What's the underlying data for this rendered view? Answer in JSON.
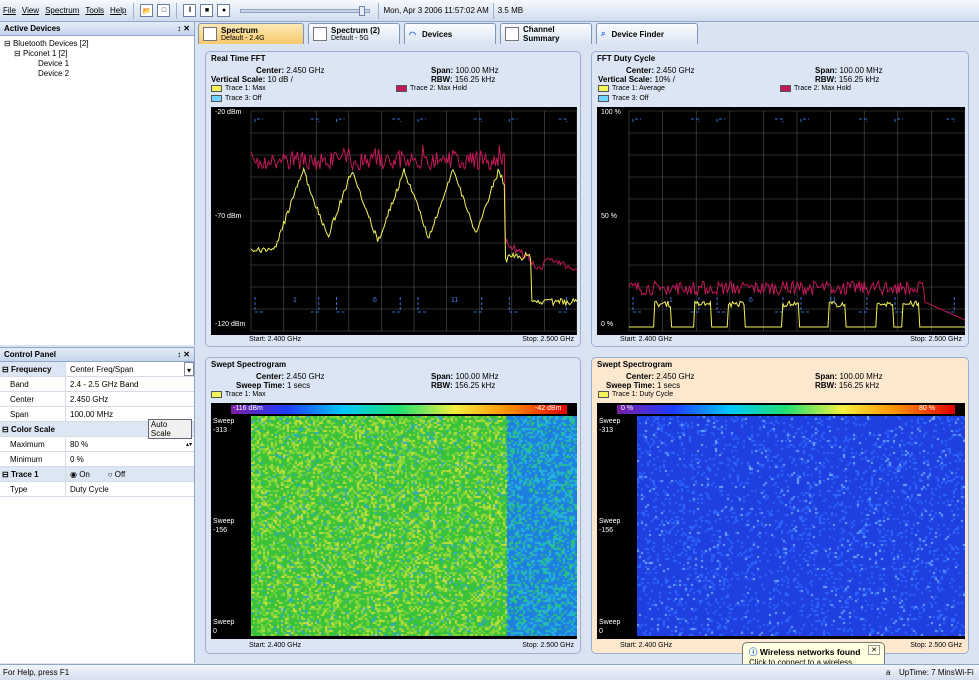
{
  "menu": {
    "file": "File",
    "view": "View",
    "spectrum": "Spectrum",
    "tools": "Tools",
    "help": "Help",
    "datetime": "Mon, Apr 3 2006 11:57:02 AM",
    "memory": "3.5 MB",
    "slider_position": 0.95
  },
  "tabs": [
    {
      "title": "Spectrum",
      "sub": "Default - 2.4G"
    },
    {
      "title": "Spectrum (2)",
      "sub": "Default - 5G"
    },
    {
      "title": "Devices",
      "sub": ""
    },
    {
      "title": "Channel",
      "sub": "Summary"
    },
    {
      "title": "Device Finder",
      "sub": ""
    }
  ],
  "active_devices": {
    "title": "Active Devices",
    "root": "Bluetooth Devices [2]",
    "piconet": "Piconet 1 [2]",
    "device1": "Device 1",
    "device2": "Device 2"
  },
  "control_panel": {
    "title": "Control Panel",
    "frequency_label": "Frequency",
    "frequency_value": "Center Freq/Span",
    "band_label": "Band",
    "band_value": "2.4 - 2.5 GHz Band",
    "center_label": "Center",
    "center_value": "2.450 GHz",
    "span_label": "Span",
    "span_value": "100.00 MHz",
    "color_scale_label": "Color Scale",
    "auto_scale": "Auto Scale",
    "maximum_label": "Maximum",
    "maximum_value": "80 %",
    "minimum_label": "Minimum",
    "minimum_value": "0 %",
    "trace_label": "Trace 1",
    "on_label": "On",
    "off_label": "Off",
    "type_label": "Type",
    "type_value": "Duty Cycle"
  },
  "fft": {
    "title": "Real Time FFT",
    "center_label": "Center:",
    "center": "2.450 GHz",
    "span_label": "Span:",
    "span": "100.00 MHz",
    "vscale_label": "Vertical Scale:",
    "vscale": "10 dB /",
    "rbw_label": "RBW:",
    "rbw": "156.25 kHz",
    "trace1": "Trace 1: Max",
    "trace2": "Trace 2: Max Hold",
    "trace3": "Trace 3: Off",
    "y_top": "-20 dBm",
    "y_mid": "-70 dBm",
    "y_bot": "-120 dBm",
    "start": "Start: 2.400 GHz",
    "stop": "Stop: 2.500 GHz",
    "ch1": "1",
    "ch6": "6",
    "ch11": "11"
  },
  "duty": {
    "title": "FFT Duty Cycle",
    "center_label": "Center:",
    "center": "2.450 GHz",
    "span_label": "Span:",
    "span": "100.00 MHz",
    "vscale_label": "Vertical Scale:",
    "vscale": "10% /",
    "rbw_label": "RBW:",
    "rbw": "156.25 kHz",
    "trace1": "Trace 1: Average",
    "trace2": "Trace 2: Max Hold",
    "trace3": "Trace 3: Off",
    "y_top": "100 %",
    "y_mid": "50 %",
    "y_bot": "0 %",
    "start": "Start: 2.400 GHz",
    "stop": "Stop: 2.500 GHz",
    "ch1": "1",
    "ch6": "6",
    "ch11": "11"
  },
  "spec1": {
    "title": "Swept Spectrogram",
    "center_label": "Center:",
    "center": "2.450 GHz",
    "span_label": "Span:",
    "span": "100.00 MHz",
    "time_label": "Sweep Time:",
    "time": "1 secs",
    "rbw_label": "RBW:",
    "rbw": "156.25 kHz",
    "trace1": "Trace 1: Max",
    "scale_min": "-116 dBm",
    "scale_max": "-42 dBm",
    "sweep_label": "Sweep",
    "s_top": "-313",
    "s_mid": "-156",
    "s_bot": "0",
    "start": "Start: 2.400 GHz",
    "stop": "Stop: 2.500 GHz"
  },
  "spec2": {
    "title": "Swept Spectrogram",
    "center_label": "Center:",
    "center": "2.450 GHz",
    "span_label": "Span:",
    "span": "100.00 MHz",
    "time_label": "Sweep Time:",
    "time": "1 secs",
    "rbw_label": "RBW:",
    "rbw": "156.25 kHz",
    "trace1": "Trace 1: Duty Cycle",
    "scale_min": "0 %",
    "scale_max": "80 %",
    "sweep_label": "Sweep",
    "s_top": "-313",
    "s_mid": "-156",
    "s_bot": "0",
    "start": "Start: 2.400 GHz",
    "stop": "Stop: 2.500 GHz"
  },
  "status": {
    "help": "For Help, press F1",
    "fragment": "a",
    "uptime": "UpTime: 7 Mins",
    "wifi": "Wi-Fi"
  },
  "balloon": {
    "title": "Wireless networks found",
    "text": "Click to connect to a wireless network."
  },
  "colors": {
    "trace_yellow": "#f2f25a",
    "trace_magenta": "#c2185b",
    "trace_cyan": "#6fd3ff",
    "channel_blue": "#3a6fd8",
    "pane_bg": "#dbe5f3",
    "pane_highlight": "#fbe8cf"
  }
}
